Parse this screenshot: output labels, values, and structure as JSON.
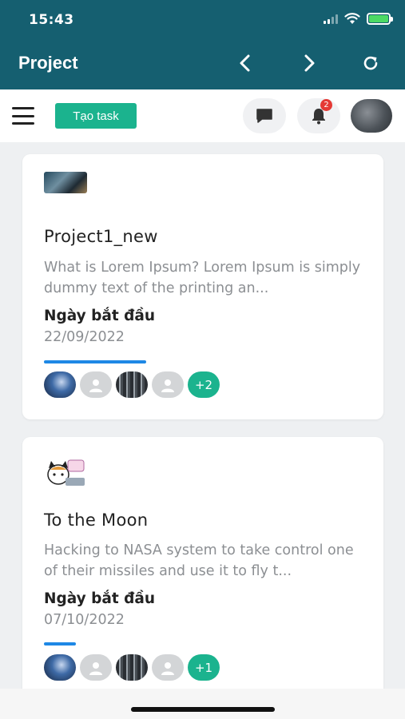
{
  "status_bar": {
    "time": "15:43"
  },
  "header": {
    "title": "Project"
  },
  "toolbar": {
    "create_task_label": "Tạo task",
    "notification_count": "2"
  },
  "projects": [
    {
      "title": "Project1_new",
      "description": "What is Lorem Ipsum?  Lorem Ipsum is simply dummy text of the printing an...",
      "start_label": "Ngày bắt đầu",
      "start_date": "22/09/2022",
      "progress_fraction": 0.32,
      "extra_members": "+2"
    },
    {
      "title": "To the Moon",
      "description": "Hacking to NASA system to take control one of their missiles and use it to fly t...",
      "start_label": "Ngày bắt đầu",
      "start_date": "07/10/2022",
      "progress_fraction": 0.1,
      "extra_members": "+1"
    }
  ],
  "colors": {
    "header_bg": "#155f70",
    "accent_green": "#1bb38e",
    "progress_blue": "#1e88e5",
    "badge_red": "#e53935"
  }
}
